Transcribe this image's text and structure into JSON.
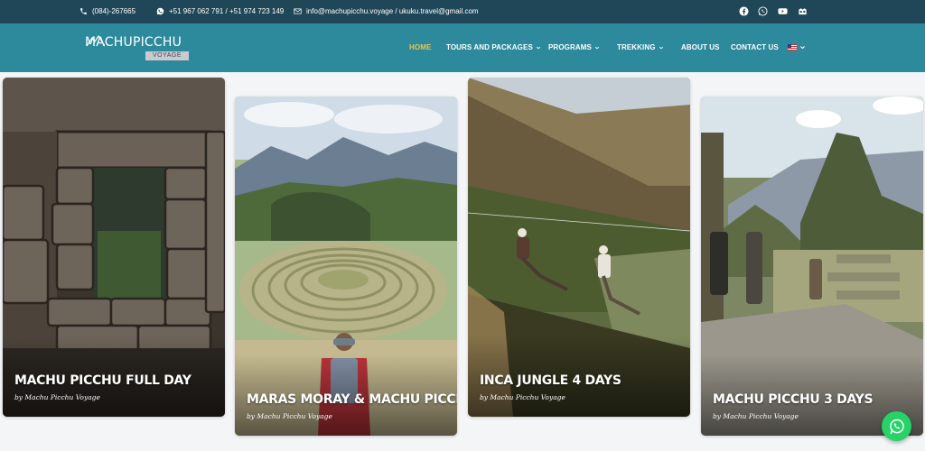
{
  "topbar": {
    "phone": "(084)-267665",
    "whatsapp": "+51 967 062 791 / +51 974 723 149",
    "email": "info@machupicchu.voyage / ukuku.travel@gmail.com",
    "social_icons": [
      "facebook-icon",
      "whatsapp-icon",
      "youtube-icon",
      "tripadvisor-icon"
    ]
  },
  "logo": {
    "word": "MACHUPICCHU",
    "badge": "VOYAGE"
  },
  "nav": {
    "items": [
      {
        "label": "HOME",
        "active": true,
        "dropdown": false
      },
      {
        "label": "TOURS AND PACKAGES",
        "active": false,
        "dropdown": true
      },
      {
        "label": "PROGRAMS",
        "active": false,
        "dropdown": true
      },
      {
        "label": "TREKKING",
        "active": false,
        "dropdown": true
      },
      {
        "label": "ABOUT US",
        "active": false,
        "dropdown": false
      },
      {
        "label": "CONTACT US",
        "active": false,
        "dropdown": false
      }
    ],
    "language": "en-flag"
  },
  "cards": [
    {
      "title": "MACHU PICCHU FULL DAY",
      "byline": "by Machu Picchu Voyage",
      "image": "inca-stone-window"
    },
    {
      "title": "MARAS MORAY & MACHU PICCHU",
      "byline": "by Machu Picchu Voyage",
      "image": "moray-terraces"
    },
    {
      "title": "INCA JUNGLE 4 DAYS",
      "byline": "by Machu Picchu Voyage",
      "image": "zipline-valley"
    },
    {
      "title": "MACHU PICCHU 3 DAYS",
      "byline": "by Machu Picchu Voyage",
      "image": "machu-picchu-ruins"
    }
  ],
  "colors": {
    "topbar": "#1f4757",
    "nav": "#2c8a9c",
    "active": "#f0c24b",
    "whatsapp": "#25d366"
  }
}
